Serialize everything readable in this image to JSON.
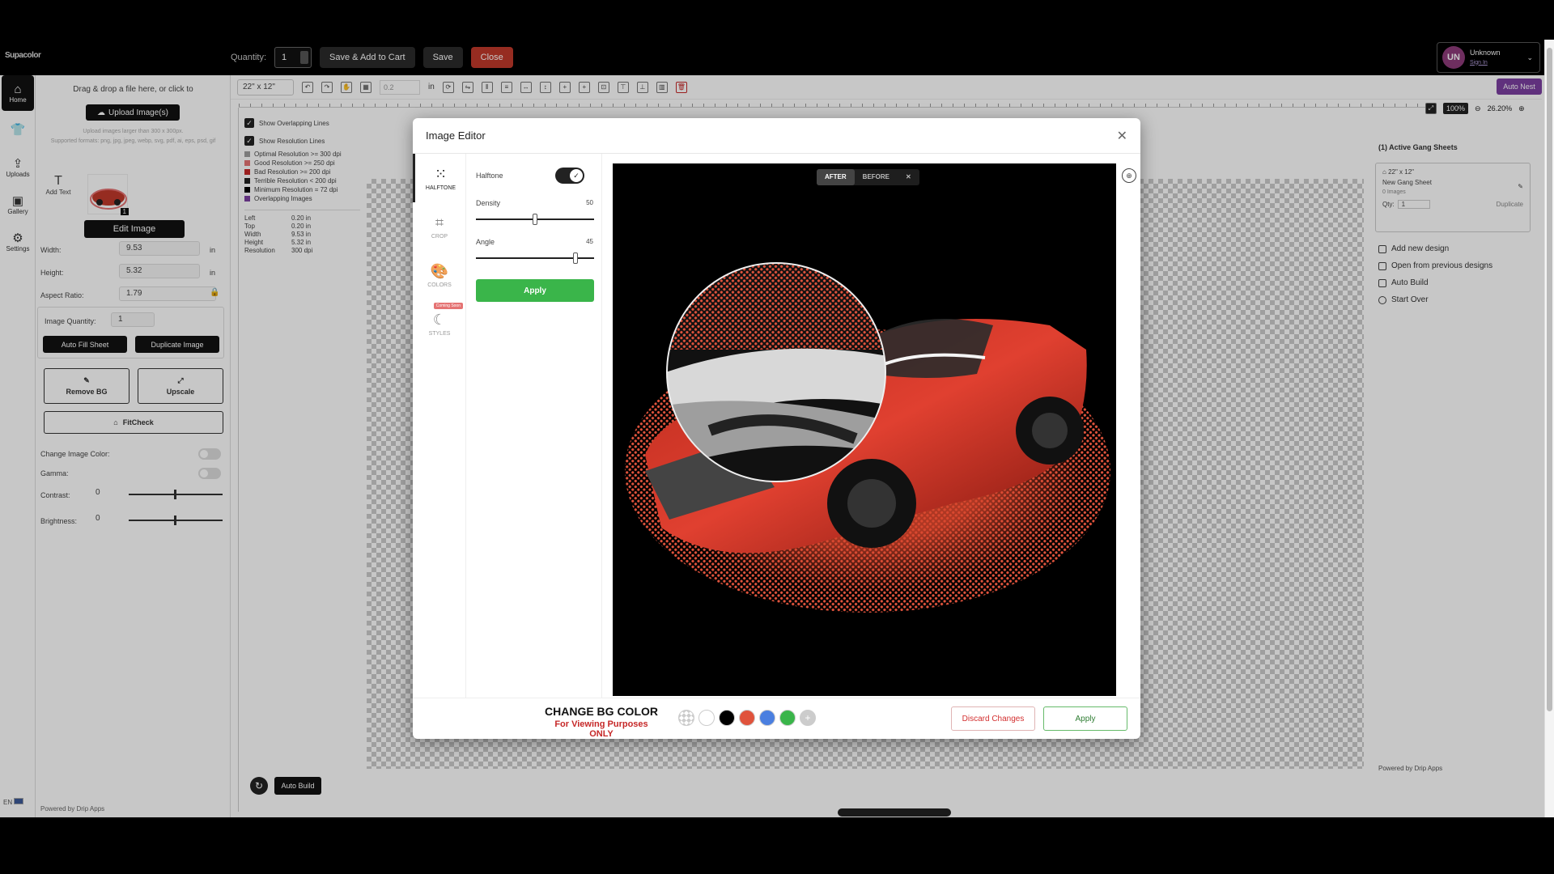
{
  "topbar": {
    "logo": "Supacolor",
    "quantity_label": "Quantity:",
    "quantity_value": "1",
    "save_add_cart": "Save & Add to Cart",
    "save": "Save",
    "close": "Close",
    "user_initials": "UN",
    "user_name": "Unknown",
    "sign_in": "Sign In"
  },
  "leftnav": {
    "items": [
      {
        "label": "Home",
        "icon": "home-icon"
      },
      {
        "label": "",
        "icon": "shirt-icon"
      },
      {
        "label": "Uploads",
        "icon": "uploads-icon"
      },
      {
        "label": "Gallery",
        "icon": "gallery-icon"
      },
      {
        "label": "Settings",
        "icon": "settings-icon"
      }
    ],
    "lang": "EN"
  },
  "leftpanel": {
    "drop_text": "Drag & drop a file here, or click to",
    "upload_btn": "Upload Image(s)",
    "hint1": "Upload images larger than 300 x 300px.",
    "hint2": "Supported formats: png, jpg, jpeg, webp, svg, pdf, ai, eps, psd, gif",
    "add_text": "Add Text",
    "thumb_badge": "1",
    "edit_image": "Edit Image",
    "width_label": "Width:",
    "width_value": "9.53",
    "height_label": "Height:",
    "height_value": "5.32",
    "unit": "in",
    "aspect_label": "Aspect Ratio:",
    "aspect_value": "1.79",
    "qty_label": "Image Quantity:",
    "qty_value": "1",
    "auto_fill": "Auto Fill Sheet",
    "duplicate_image": "Duplicate Image",
    "remove_bg": "Remove BG",
    "upscale": "Upscale",
    "fitcheck": "FitCheck",
    "change_color": "Change Image Color:",
    "gamma": "Gamma:",
    "contrast": "Contrast:",
    "contrast_value": "0",
    "brightness": "Brightness:",
    "brightness_value": "0",
    "powered": "Powered by Drip Apps"
  },
  "workarea": {
    "size": "22\" x 12\"",
    "step_value": "0.2",
    "step_unit": "in",
    "auto_nest": "Auto Nest",
    "zoom_fit": "100%",
    "zoom_value": "26.20%",
    "show_overlap": "Show Overlapping Lines",
    "show_res": "Show Resolution Lines",
    "legend": [
      {
        "label": "Optimal Resolution >= 300 dpi",
        "color": "#9e9e9e"
      },
      {
        "label": "Good Resolution >= 250 dpi",
        "color": "#e57373"
      },
      {
        "label": "Bad Resolution >= 200 dpi",
        "color": "#c62828"
      },
      {
        "label": "Terrible Resolution < 200 dpi",
        "color": "#212121"
      },
      {
        "label": "Minimum Resolution = 72 dpi",
        "color": "#000000"
      },
      {
        "label": "Overlapping Images",
        "color": "#7b3fa0"
      }
    ],
    "info": [
      {
        "k": "Left",
        "v": "0.20 in"
      },
      {
        "k": "Top",
        "v": "0.20 in"
      },
      {
        "k": "Width",
        "v": "9.53 in"
      },
      {
        "k": "Height",
        "v": "5.32 in"
      },
      {
        "k": "Resolution",
        "v": "300 dpi"
      }
    ],
    "auto_build": "Auto Build"
  },
  "rightpanel": {
    "title": "(1) Active Gang Sheets",
    "sheet_size": "22\" x 12\"",
    "sheet_name": "New Gang Sheet",
    "sheet_images": "0 Images",
    "qty_label": "Qty:",
    "qty_value": "1",
    "duplicate": "Duplicate",
    "actions": [
      "Add new design",
      "Open from previous designs",
      "Auto Build",
      "Start Over"
    ],
    "powered": "Powered by Drip Apps"
  },
  "modal": {
    "title": "Image Editor",
    "tools": [
      {
        "label": "HALFTONE",
        "icon": "grid-dots-icon"
      },
      {
        "label": "CROP",
        "icon": "crop-icon"
      },
      {
        "label": "COLORS",
        "icon": "palette-icon"
      },
      {
        "label": "STYLES",
        "icon": "styles-icon",
        "badge": "Coming Soon"
      }
    ],
    "halftone_label": "Halftone",
    "density_label": "Density",
    "density_value": "50",
    "angle_label": "Angle",
    "angle_value": "45",
    "apply": "Apply",
    "after": "AFTER",
    "before": "BEFORE",
    "bg_title": "CHANGE BG COLOR",
    "bg_sub": "For Viewing Purposes ONLY",
    "swatches": [
      "transparent",
      "#ffffff",
      "#000000",
      "#e0533c",
      "#4a7fe0",
      "#3ab54a",
      "#cccccc"
    ],
    "discard": "Discard Changes",
    "apply_footer": "Apply"
  }
}
